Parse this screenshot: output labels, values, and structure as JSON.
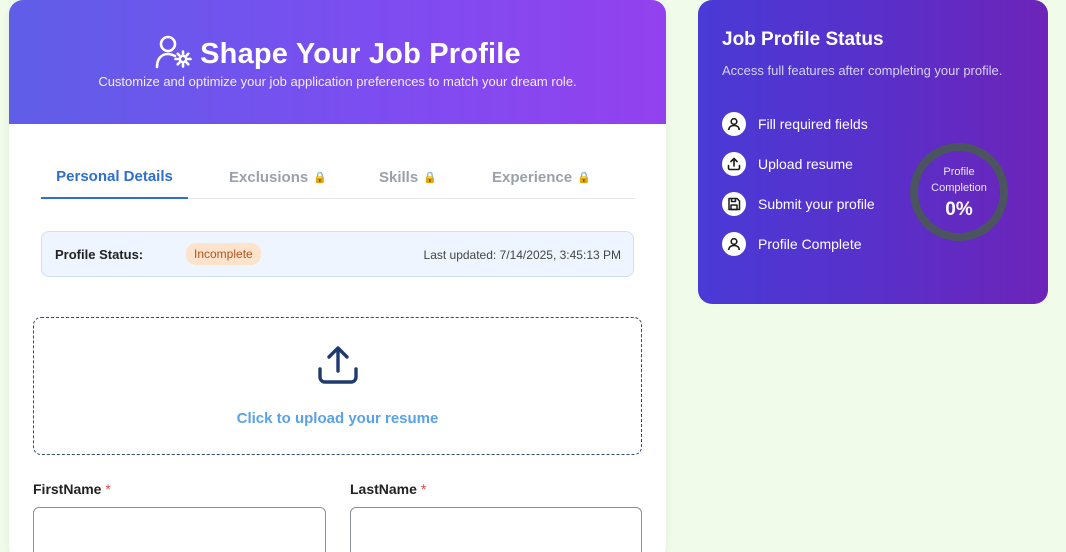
{
  "hero": {
    "title": "Shape Your Job Profile",
    "subtitle": "Customize and optimize your job application preferences to match your dream role."
  },
  "tabs": [
    {
      "label": "Personal Details",
      "active": true,
      "locked": false
    },
    {
      "label": "Exclusions",
      "active": false,
      "locked": true
    },
    {
      "label": "Skills",
      "active": false,
      "locked": true
    },
    {
      "label": "Experience",
      "active": false,
      "locked": true
    }
  ],
  "profile_status": {
    "label": "Profile Status:",
    "badge": "Incomplete",
    "last_updated": "Last updated: 7/14/2025, 3:45:13 PM"
  },
  "upload": {
    "label": "Click to upload your resume"
  },
  "form": {
    "first_name_label": "FirstName",
    "last_name_label": "LastName",
    "required_mark": "*"
  },
  "status_card": {
    "title": "Job Profile Status",
    "subtitle": "Access full features after completing your profile.",
    "steps": [
      {
        "label": "Fill required fields",
        "icon": "user-icon"
      },
      {
        "label": "Upload resume",
        "icon": "upload-icon"
      },
      {
        "label": "Submit your profile",
        "icon": "save-icon"
      },
      {
        "label": "Profile Complete",
        "icon": "user-icon"
      }
    ],
    "completion_label_line1": "Profile",
    "completion_label_line2": "Completion",
    "completion_percent": "0%",
    "completion_value": 0
  },
  "colors": {
    "accent": "#2f6fcf",
    "hero_start": "#5f5ee8",
    "hero_end": "#9341ee",
    "status_card_start": "#4a3ad6",
    "status_card_end": "#6d24b8",
    "badge_bg": "#fde3cb",
    "badge_text": "#b3541e",
    "page_bg": "#f1fbe9"
  }
}
